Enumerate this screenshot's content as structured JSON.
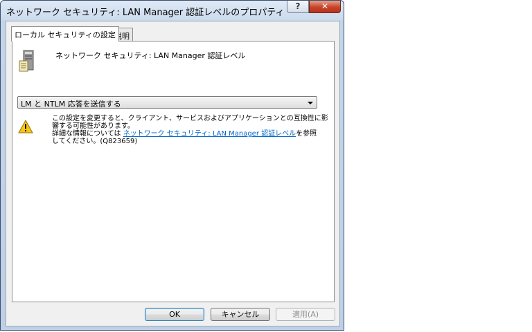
{
  "window": {
    "title": "ネットワーク セキュリティ: LAN Manager 認証レベルのプロパティ",
    "help_label": "?",
    "close_label": "✕"
  },
  "tabs": [
    {
      "label": "ローカル セキュリティの設定",
      "active": true
    },
    {
      "label": "説明",
      "active": false
    }
  ],
  "policy": {
    "icon": "server-icon",
    "name": "ネットワーク セキュリティ: LAN Manager 認証レベル"
  },
  "setting": {
    "selected": "LM と NTLM 応答を送信する"
  },
  "warning": {
    "icon": "warning-icon",
    "line1": "この設定を変更すると、クライアント、サービスおよびアプリケーションとの互換性に影",
    "line2": "響する可能性があります。",
    "line3_prefix": "詳細な情報については ",
    "link_text": "ネットワーク セキュリティ: LAN Manager 認証レベル",
    "line3_suffix": "を参照",
    "line4": "してください。(Q823659)"
  },
  "buttons": {
    "ok": "OK",
    "cancel": "キャンセル",
    "apply": "適用(A)"
  },
  "colors": {
    "link": "#0066cc",
    "close_button": "#c7442a",
    "titlebar": "#cddcee"
  }
}
